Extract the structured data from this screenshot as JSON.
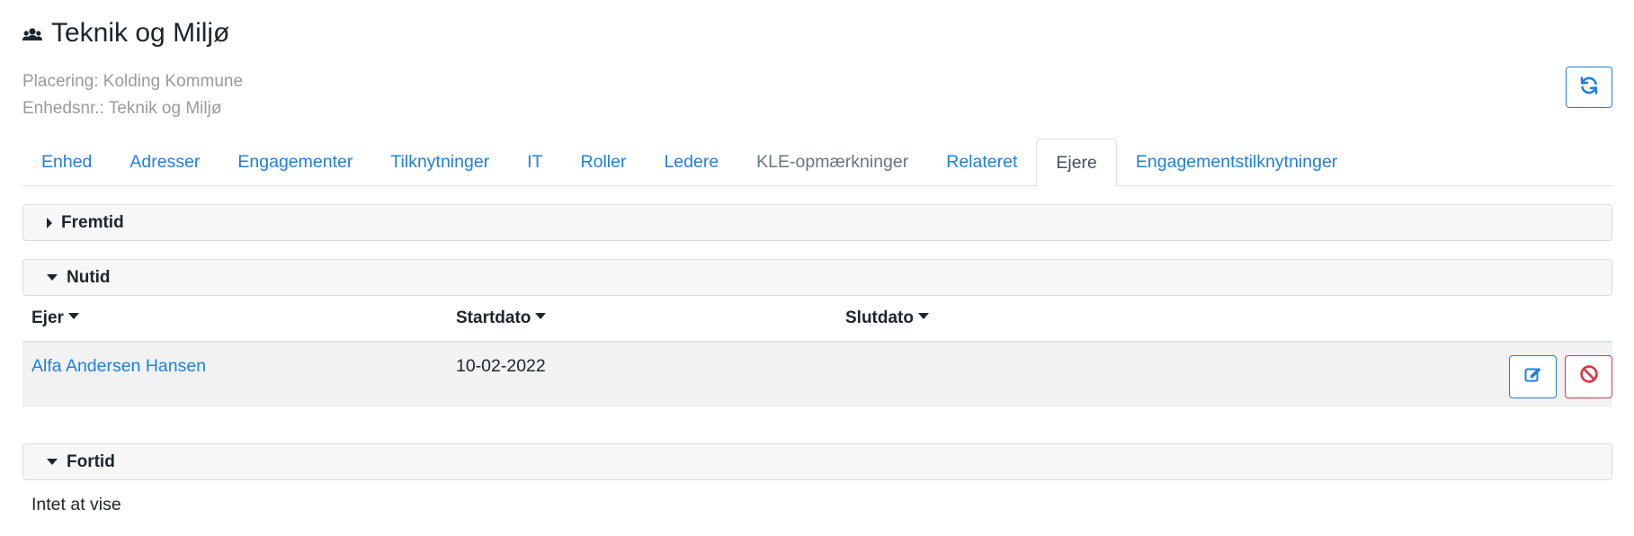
{
  "header": {
    "title": "Teknik og Miljø",
    "placement": "Placering: Kolding Kommune",
    "unit_number": "Enhedsnr.: Teknik og Miljø"
  },
  "tabs": [
    {
      "label": "Enhed",
      "state": "link"
    },
    {
      "label": "Adresser",
      "state": "link"
    },
    {
      "label": "Engagementer",
      "state": "link"
    },
    {
      "label": "Tilknytninger",
      "state": "link"
    },
    {
      "label": "IT",
      "state": "link"
    },
    {
      "label": "Roller",
      "state": "link"
    },
    {
      "label": "Ledere",
      "state": "link"
    },
    {
      "label": "KLE-opmærkninger",
      "state": "disabled"
    },
    {
      "label": "Relateret",
      "state": "link"
    },
    {
      "label": "Ejere",
      "state": "active"
    },
    {
      "label": "Engagementstilknytninger",
      "state": "link"
    }
  ],
  "sections": {
    "future": {
      "label": "Fremtid",
      "expanded": false
    },
    "present": {
      "label": "Nutid",
      "expanded": true
    },
    "past": {
      "label": "Fortid",
      "expanded": true,
      "empty_text": "Intet at vise"
    }
  },
  "table": {
    "columns": [
      "Ejer",
      "Startdato",
      "Slutdato"
    ],
    "rows": [
      {
        "owner": "Alfa Andersen Hansen",
        "start": "10-02-2022",
        "end": ""
      }
    ]
  },
  "colors": {
    "link": "#1e7fe0",
    "danger": "#dc3545",
    "muted": "#9a9a9a"
  },
  "icons": {
    "title": "users-icon",
    "refresh": "refresh-icon",
    "edit": "edit-icon",
    "terminate": "ban-icon"
  }
}
